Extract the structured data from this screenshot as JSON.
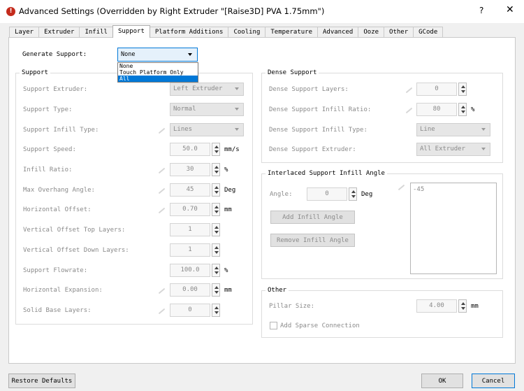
{
  "window": {
    "title": "Advanced Settings (Overridden by Right Extruder \"[Raise3D] PVA 1.75mm\")",
    "help_label": "?",
    "close_label": "✕",
    "alert_icon": "!"
  },
  "tabs": [
    "Layer",
    "Extruder",
    "Infill",
    "Support",
    "Platform Additions",
    "Cooling",
    "Temperature",
    "Advanced",
    "Ooze",
    "Other",
    "GCode"
  ],
  "active_tab": "Support",
  "generate_support": {
    "label": "Generate Support:",
    "value": "None",
    "options": [
      "None",
      "Touch Platform Only",
      "All"
    ],
    "highlighted_option": "All"
  },
  "support_group": {
    "title": "Support",
    "fields": [
      {
        "label": "Support Extruder:",
        "type": "combo",
        "value": "Left Extruder"
      },
      {
        "label": "Support Type:",
        "type": "combo",
        "value": "Normal"
      },
      {
        "label": "Support Infill Type:",
        "type": "combo",
        "value": "Lines"
      },
      {
        "label": "Support Speed:",
        "type": "spin",
        "value": "50.0",
        "unit": "mm/s"
      },
      {
        "label": "Infill Ratio:",
        "type": "spin",
        "value": "30",
        "unit": "%"
      },
      {
        "label": "Max Overhang Angle:",
        "type": "spin",
        "value": "45",
        "unit": "Deg"
      },
      {
        "label": "Horizontal Offset:",
        "type": "spin",
        "value": "0.70",
        "unit": "mm"
      },
      {
        "label": "Vertical Offset Top Layers:",
        "type": "spin",
        "value": "1",
        "unit": ""
      },
      {
        "label": "Vertical Offset Down Layers:",
        "type": "spin",
        "value": "1",
        "unit": ""
      },
      {
        "label": "Support Flowrate:",
        "type": "spin",
        "value": "100.0",
        "unit": "%"
      },
      {
        "label": "Horizontal Expansion:",
        "type": "spin",
        "value": "0.00",
        "unit": "mm"
      },
      {
        "label": "Solid Base Layers:",
        "type": "spin",
        "value": "0",
        "unit": ""
      }
    ]
  },
  "dense_support_group": {
    "title": "Dense Support",
    "fields": [
      {
        "label": "Dense Support Layers:",
        "type": "spin",
        "value": "0",
        "unit": ""
      },
      {
        "label": "Dense Support Infill Ratio:",
        "type": "spin",
        "value": "80",
        "unit": "%"
      },
      {
        "label": "Dense Support Infill Type:",
        "type": "combo",
        "value": "Line"
      },
      {
        "label": "Dense Support Extruder:",
        "type": "combo",
        "value": "All Extruder"
      }
    ]
  },
  "interlaced_group": {
    "title": "Interlaced Support Infill Angle",
    "angle_label": "Angle:",
    "angle_value": "0",
    "angle_unit": "Deg",
    "add_button": "Add Infill Angle",
    "remove_button": "Remove Infill Angle",
    "angles_list": "-45"
  },
  "other_group": {
    "title": "Other",
    "pillar_label": "Pillar Size:",
    "pillar_value": "4.00",
    "pillar_unit": "mm",
    "sparse_label": "Add Sparse Connection"
  },
  "footer": {
    "restore_label": "Restore Defaults",
    "ok_label": "OK",
    "cancel_label": "Cancel"
  },
  "colors": {
    "accent": "#0078d7",
    "alert": "#c42b1c"
  }
}
